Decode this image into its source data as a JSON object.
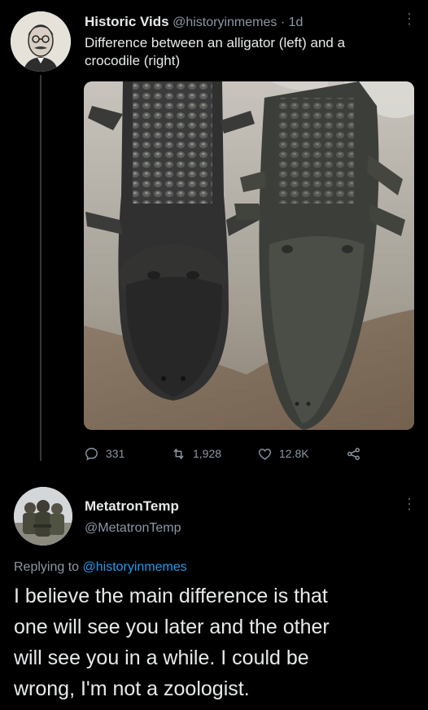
{
  "tweet": {
    "display_name": "Historic Vids",
    "handle": "@historyinmemes",
    "separator": "·",
    "time": "1d",
    "text_line1": "Difference between an alligator (left) and a",
    "text_line2": "crocodile (right)",
    "avatar_icon": "portrait-avatar-icon",
    "media_icon": "alligator-crocodile-photo",
    "actions": {
      "replies": "331",
      "retweets": "1,928",
      "likes": "12.8K"
    }
  },
  "reply": {
    "display_name": "MetatronTemp",
    "handle": "@MetatronTemp",
    "replying_prefix": "Replying to",
    "replying_to": "@historyinmemes",
    "text_lines": [
      "I believe the main difference is that",
      "one will see you later and the other",
      "will see you in a while. I could be",
      "wrong, I'm not a zoologist."
    ]
  },
  "colors": {
    "background": "#000000",
    "text": "#e7e9ea",
    "muted": "#8b98a5",
    "link": "#1d9bf0"
  }
}
